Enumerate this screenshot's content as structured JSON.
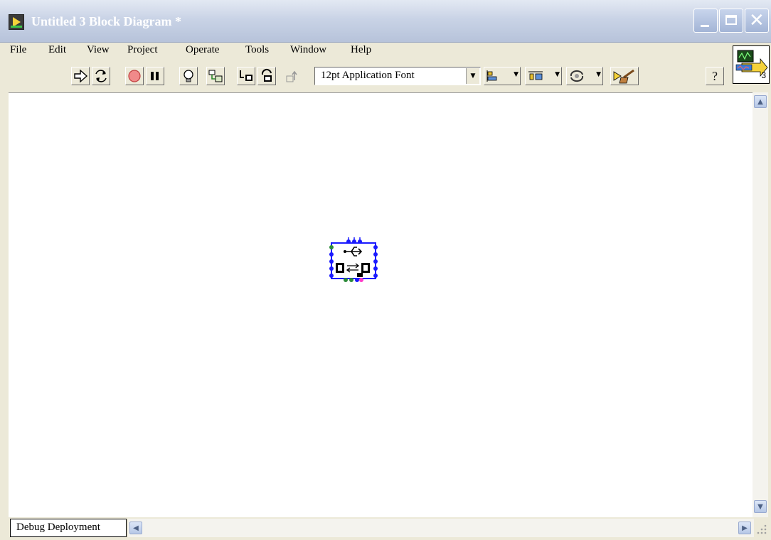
{
  "window": {
    "title": "Untitled 3 Block Diagram *",
    "min_label": "minimize",
    "max_label": "maximize",
    "close_label": "close"
  },
  "menu": {
    "items": [
      {
        "label": "File"
      },
      {
        "label": "Edit"
      },
      {
        "label": "View"
      },
      {
        "label": "Project"
      },
      {
        "label": "Operate"
      },
      {
        "label": "Tools"
      },
      {
        "label": "Window"
      },
      {
        "label": "Help"
      }
    ]
  },
  "toolbar": {
    "run_icon": "run-arrow-icon",
    "run_continuously_icon": "run-continuously-icon",
    "abort_icon": "abort-icon",
    "pause_icon": "pause-icon",
    "highlight_icon": "highlight-execution-icon",
    "retain_wire_icon": "retain-wire-values-icon",
    "step_into_icon": "step-into-icon",
    "step_over_icon": "step-over-icon",
    "step_out_icon": "step-out-icon",
    "font": "12pt Application Font",
    "align_icon": "align-objects-icon",
    "distribute_icon": "distribute-objects-icon",
    "reorder_icon": "reorder-icon",
    "cleanup_icon": "clean-up-diagram-icon",
    "help_icon": "context-help-icon",
    "vi_icon_number": "3"
  },
  "canvas": {
    "node_icon": "usb-subvi-icon"
  },
  "bottom": {
    "target": "Debug Deployment"
  },
  "colors": {
    "title_text": "#ffffff",
    "node_border": "#1a1aff",
    "terminal_green": "#2e8b3a",
    "terminal_pink": "#ff3cc8"
  }
}
